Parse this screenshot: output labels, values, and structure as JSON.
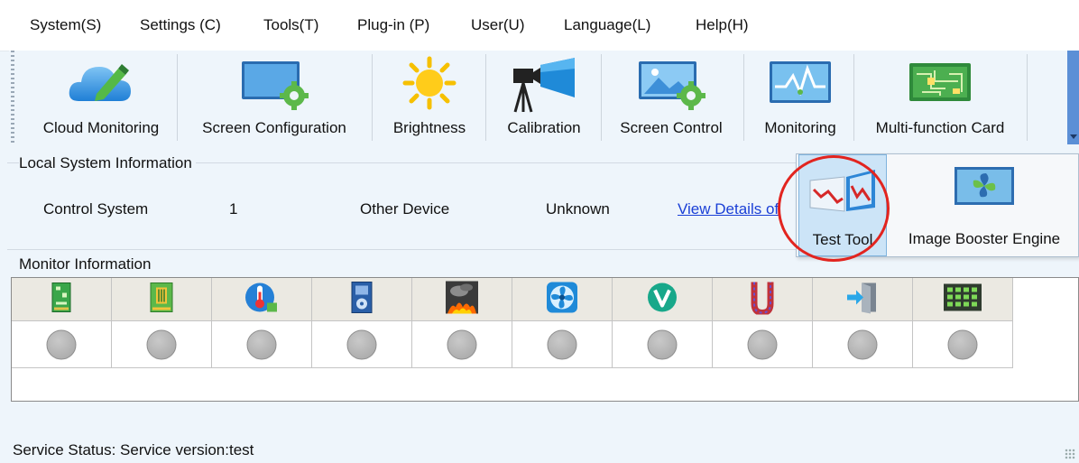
{
  "menu": {
    "items": [
      "System(S)",
      "Settings (C)",
      "Tools(T)",
      "Plug-in (P)",
      "User(U)",
      "Language(L)",
      "Help(H)"
    ]
  },
  "toolbar": {
    "buttons": [
      {
        "label": "Cloud Monitoring",
        "icon": "cloud-pencil-icon"
      },
      {
        "label": "Screen Configuration",
        "icon": "screen-gear-icon"
      },
      {
        "label": "Brightness",
        "icon": "sun-icon"
      },
      {
        "label": "Calibration",
        "icon": "camera-tripod-icon"
      },
      {
        "label": "Screen Control",
        "icon": "screen-picture-gear-icon"
      },
      {
        "label": "Monitoring",
        "icon": "monitor-wave-icon"
      },
      {
        "label": "Multi-function Card",
        "icon": "circuit-board-icon"
      }
    ]
  },
  "local_system": {
    "title": "Local System Information",
    "control_system_label": "Control System",
    "control_system_value": "1",
    "other_device_label": "Other Device",
    "other_device_value": "Unknown",
    "view_details_link": "View Details of"
  },
  "plugin_popup": {
    "items": [
      {
        "label": "Test Tool",
        "icon": "test-chart-icon",
        "selected": true
      },
      {
        "label": "Image Booster Engine",
        "icon": "image-booster-icon",
        "selected": false
      }
    ]
  },
  "monitor": {
    "title": "Monitor Information",
    "columns": [
      {
        "icon": "green-board-icon",
        "status": "gray"
      },
      {
        "icon": "receiving-card-icon",
        "status": "gray"
      },
      {
        "icon": "thermometer-icon",
        "status": "gray"
      },
      {
        "icon": "fan-board-icon",
        "status": "gray"
      },
      {
        "icon": "smoke-fire-icon",
        "status": "gray"
      },
      {
        "icon": "fan-icon",
        "status": "gray"
      },
      {
        "icon": "voltage-icon",
        "status": "gray"
      },
      {
        "icon": "cable-icon",
        "status": "gray"
      },
      {
        "icon": "door-icon",
        "status": "gray"
      },
      {
        "icon": "module-grid-icon",
        "status": "gray"
      }
    ]
  },
  "status_bar": {
    "text": "Service Status:  Service version:test"
  },
  "colors": {
    "link": "#1a3fd6",
    "annotation_ring": "#e2241f",
    "popup_selected_bg": "#cce4f7",
    "window_bg": "#eef5fb"
  }
}
